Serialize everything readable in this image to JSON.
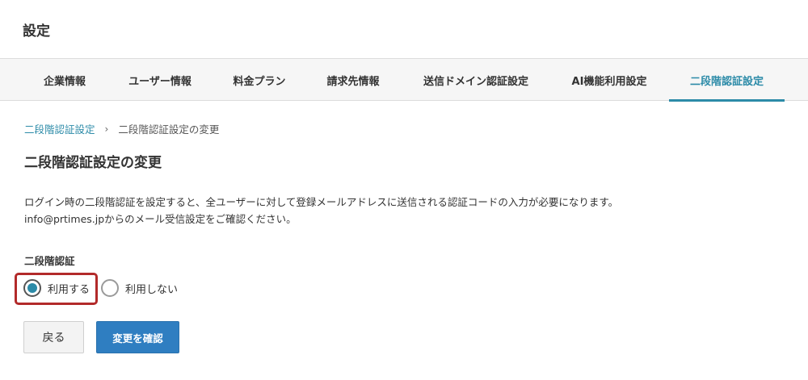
{
  "page": {
    "title": "設定"
  },
  "tabs": [
    {
      "label": "企業情報",
      "active": false
    },
    {
      "label": "ユーザー情報",
      "active": false
    },
    {
      "label": "料金プラン",
      "active": false
    },
    {
      "label": "請求先情報",
      "active": false
    },
    {
      "label": "送信ドメイン認証設定",
      "active": false
    },
    {
      "label": "AI機能利用設定",
      "active": false
    },
    {
      "label": "二段階認証設定",
      "active": true
    }
  ],
  "breadcrumb": {
    "parent": "二段階認証設定",
    "separator": "›",
    "current": "二段階認証設定の変更"
  },
  "section": {
    "title": "二段階認証設定の変更",
    "description_line1": "ログイン時の二段階認証を設定すると、全ユーザーに対して登録メールアドレスに送信される認証コードの入力が必要になります。",
    "description_line2": "info@prtimes.jpからのメール受信設定をご確認ください。"
  },
  "two_factor": {
    "label": "二段階認証",
    "options": [
      {
        "label": "利用する",
        "selected": true
      },
      {
        "label": "利用しない",
        "selected": false
      }
    ]
  },
  "buttons": {
    "back": "戻る",
    "confirm": "変更を確認"
  },
  "colors": {
    "accent": "#2c8ba8",
    "primary_button": "#2f7ec1",
    "highlight_border": "#b22a2a"
  }
}
